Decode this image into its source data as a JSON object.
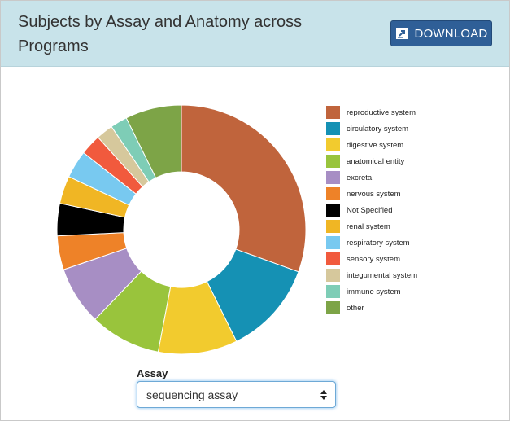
{
  "header": {
    "title": "Subjects by Assay and Anatomy across Programs",
    "download_label": "DOWNLOAD",
    "download_icon": "download-icon"
  },
  "filter": {
    "label": "Assay",
    "selected": "sequencing assay"
  },
  "colors": {
    "header_bg": "#c8e3ea",
    "button_bg": "#2f5f97"
  },
  "chart_data": {
    "type": "pie",
    "donut": true,
    "title": "",
    "legend_position": "right",
    "slices": [
      {
        "label": "reproductive system",
        "value": 30.5,
        "color": "#c0643c"
      },
      {
        "label": "circulatory system",
        "value": 12.2,
        "color": "#1591b4"
      },
      {
        "label": "digestive system",
        "value": 10.3,
        "color": "#f2cb2e"
      },
      {
        "label": "anatomical entity",
        "value": 9.2,
        "color": "#99c43c"
      },
      {
        "label": "excreta",
        "value": 7.6,
        "color": "#a78ec4"
      },
      {
        "label": "nervous system",
        "value": 4.4,
        "color": "#ee8228"
      },
      {
        "label": "Not Specified",
        "value": 4.2,
        "color": "#000000"
      },
      {
        "label": "renal system",
        "value": 3.6,
        "color": "#f0b624"
      },
      {
        "label": "respiratory system",
        "value": 3.6,
        "color": "#78c9f0"
      },
      {
        "label": "sensory system",
        "value": 2.7,
        "color": "#f15a3d"
      },
      {
        "label": "integumental system",
        "value": 2.2,
        "color": "#d6c89c"
      },
      {
        "label": "immune system",
        "value": 2.2,
        "color": "#7ecdb6"
      },
      {
        "label": "other",
        "value": 7.3,
        "color": "#7da447"
      }
    ]
  }
}
